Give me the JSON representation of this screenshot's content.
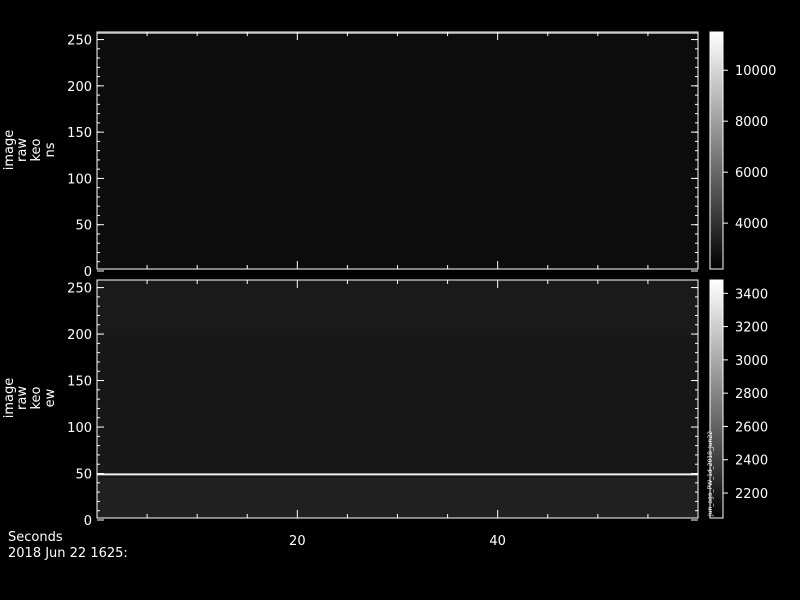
{
  "chart_data": [
    {
      "type": "heatmap",
      "ylabel_lines": [
        "image",
        "raw",
        "keo",
        "ns"
      ],
      "ylim": [
        0,
        256
      ],
      "y_ticks": [
        0,
        50,
        100,
        150,
        200,
        250
      ],
      "xlim": [
        0,
        60
      ],
      "x_ticks_major": [
        20,
        40
      ],
      "colorbar": {
        "range": [
          2200,
          11500
        ],
        "ticks": [
          4000,
          6000,
          8000,
          10000
        ]
      },
      "background_intensity": 2600,
      "features": [
        {
          "kind": "bright_band",
          "y": 255,
          "intensity": 11500
        }
      ]
    },
    {
      "type": "heatmap",
      "ylabel_lines": [
        "image",
        "raw",
        "keo",
        "ew"
      ],
      "ylim": [
        0,
        256
      ],
      "y_ticks": [
        0,
        50,
        100,
        150,
        200,
        250
      ],
      "xlim": [
        0,
        60
      ],
      "x_ticks_major": [
        20,
        40
      ],
      "colorbar": {
        "range": [
          2050,
          3480
        ],
        "ticks": [
          2200,
          2400,
          2600,
          2800,
          3000,
          3200,
          3400
        ]
      },
      "background_intensity": 2250,
      "features": [
        {
          "kind": "bright_line",
          "y": 48,
          "intensity": 3480
        }
      ],
      "colorbar_credit": "Jun_ago_PW_1d_2018_Jun22"
    }
  ],
  "x_axis": {
    "label": "Seconds",
    "tick_labels": [
      "20",
      "40"
    ]
  },
  "footer_date": "2018 Jun 22 1625:"
}
